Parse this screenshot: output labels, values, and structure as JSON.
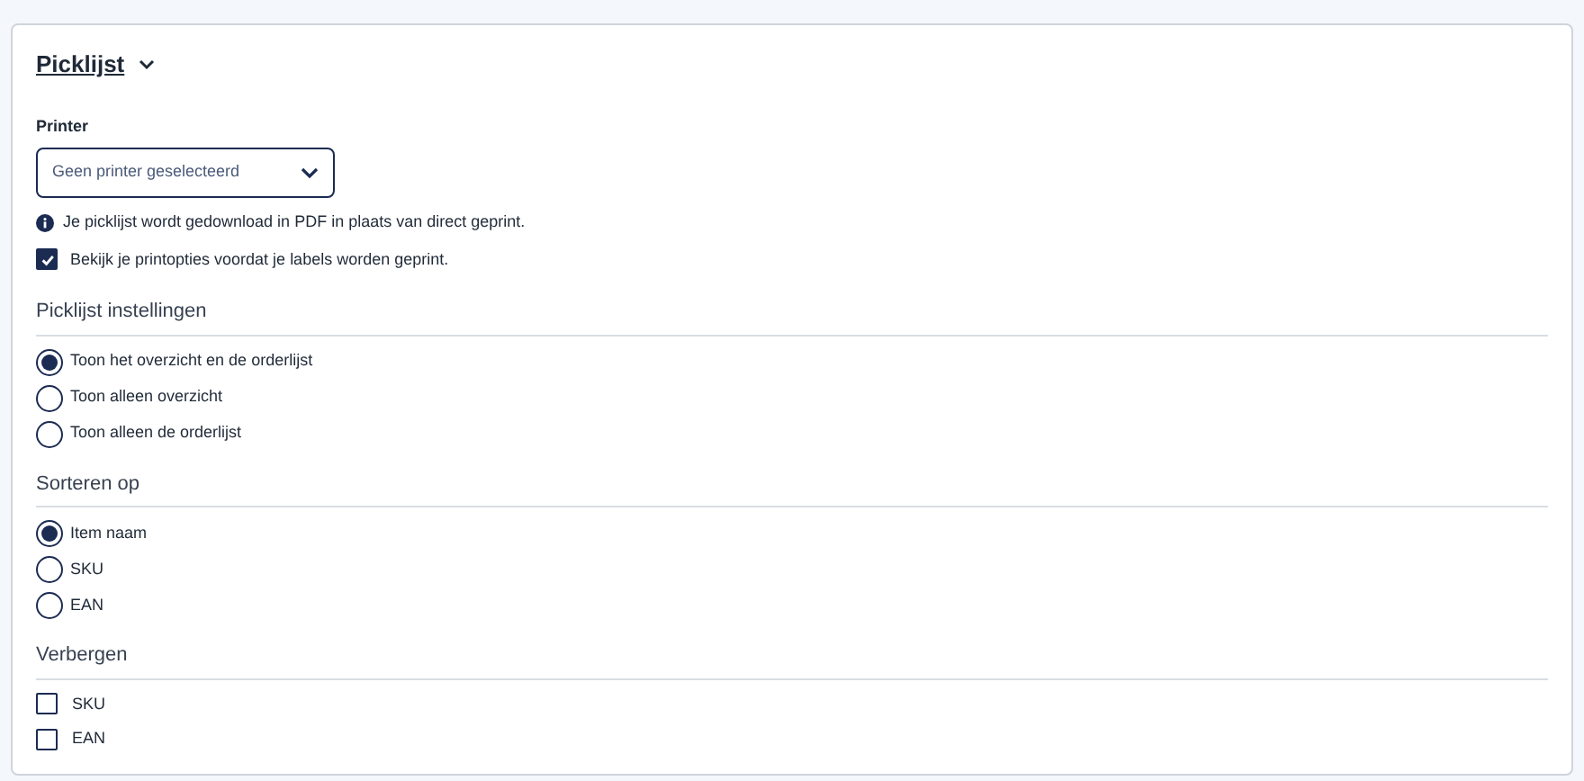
{
  "title": "Picklijst",
  "printer": {
    "label": "Printer",
    "value": "Geen printer geselecteerd"
  },
  "info": "Je picklijst wordt gedownload in PDF in plaats van direct geprint.",
  "preview": {
    "label": "Bekijk je printopties voordat je labels worden geprint.",
    "checked": true
  },
  "sections": [
    {
      "heading": "Picklijst instellingen",
      "kind": "radio",
      "options": [
        {
          "label": "Toon het overzicht en de orderlijst",
          "selected": true
        },
        {
          "label": "Toon alleen overzicht",
          "selected": false
        },
        {
          "label": "Toon alleen de orderlijst",
          "selected": false
        }
      ]
    },
    {
      "heading": "Sorteren op",
      "kind": "radio",
      "options": [
        {
          "label": "Item naam",
          "selected": true
        },
        {
          "label": "SKU",
          "selected": false
        },
        {
          "label": "EAN",
          "selected": false
        }
      ]
    },
    {
      "heading": "Verbergen",
      "kind": "checkbox",
      "options": [
        {
          "label": "SKU",
          "checked": false
        },
        {
          "label": "EAN",
          "checked": false
        }
      ]
    }
  ]
}
